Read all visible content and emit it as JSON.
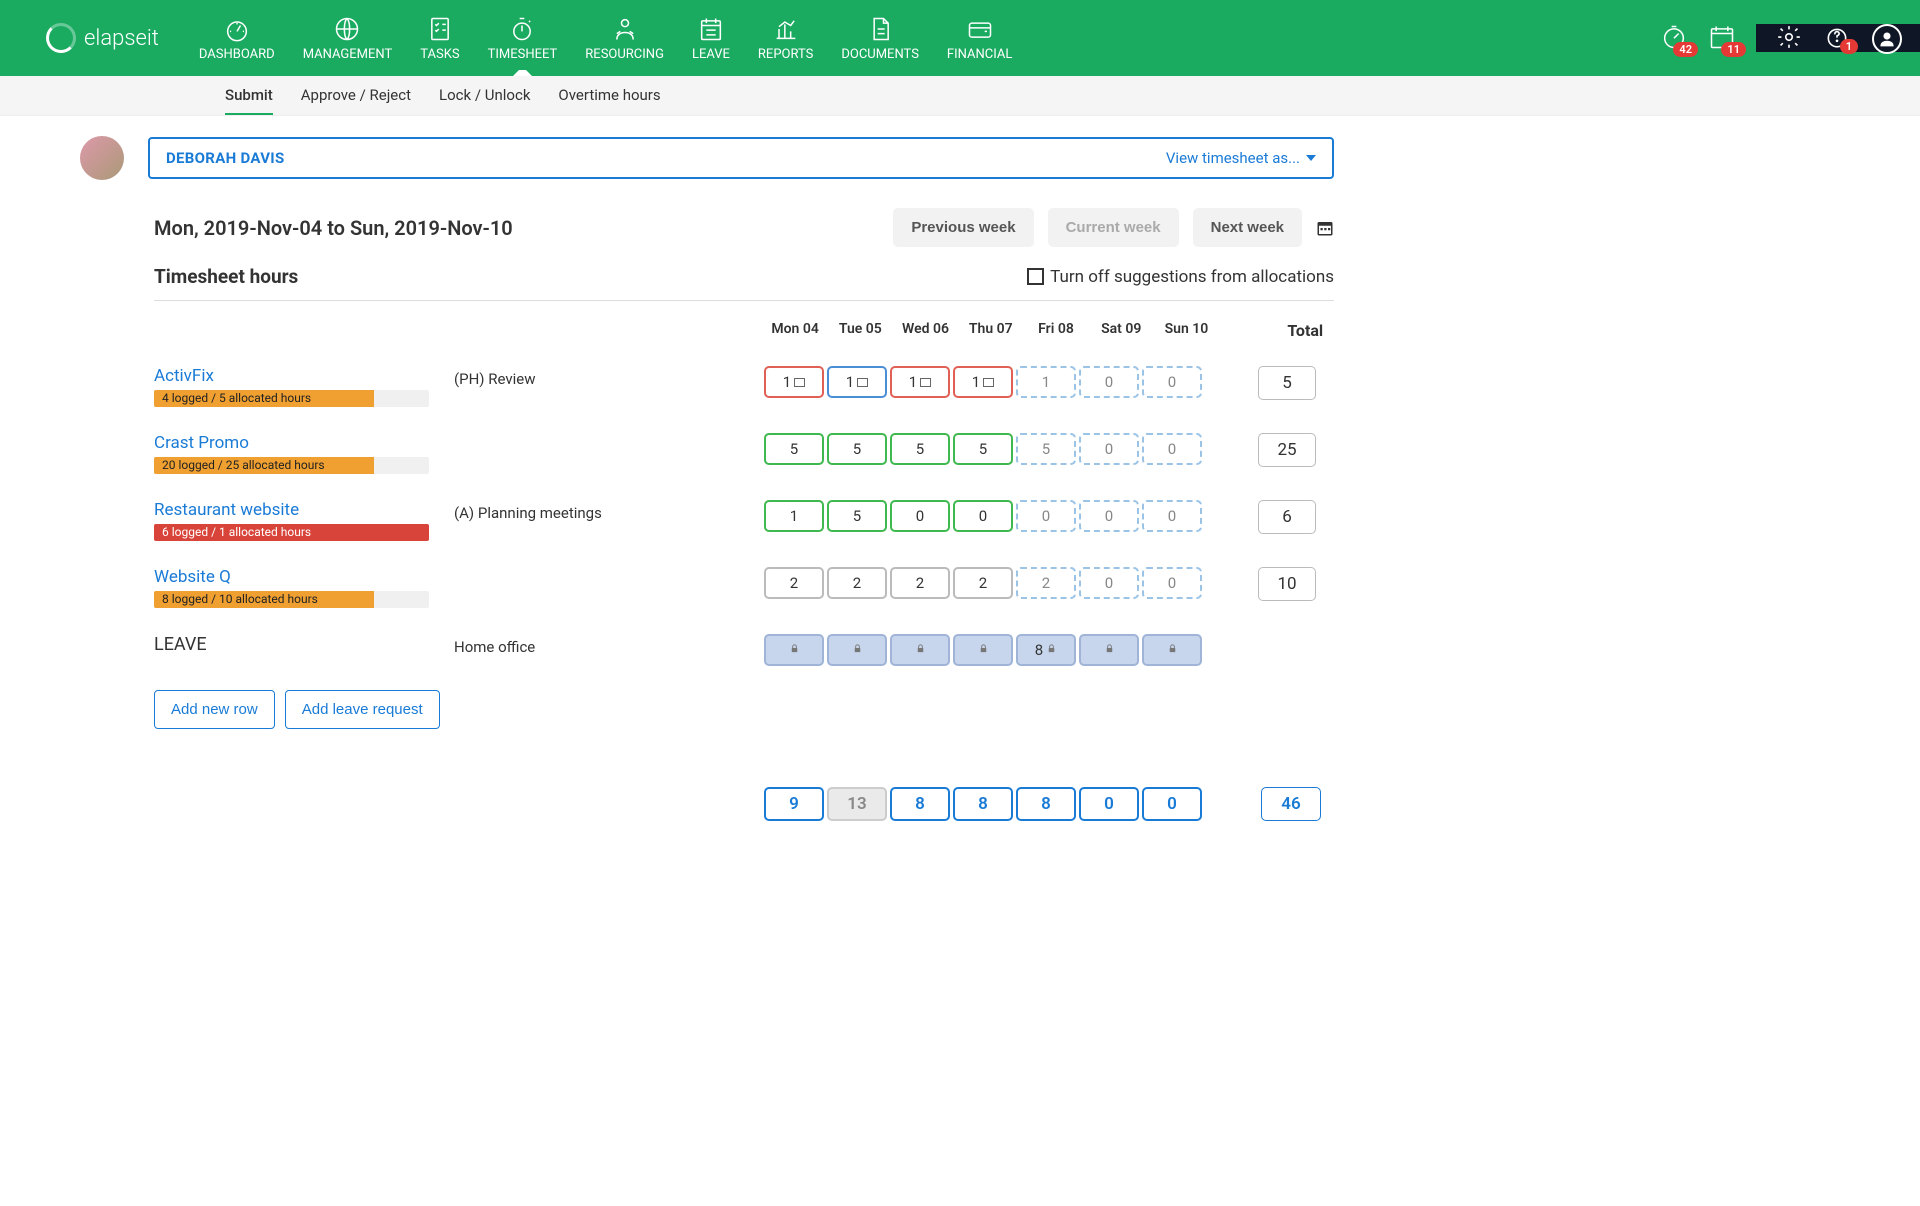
{
  "brand": "elapseit",
  "nav": {
    "items": [
      {
        "label": "DASHBOARD",
        "icon": "dashboard"
      },
      {
        "label": "MANAGEMENT",
        "icon": "globe"
      },
      {
        "label": "TASKS",
        "icon": "checklist"
      },
      {
        "label": "TIMESHEET",
        "icon": "stopwatch",
        "active": true
      },
      {
        "label": "RESOURCING",
        "icon": "person"
      },
      {
        "label": "LEAVE",
        "icon": "leave-cal"
      },
      {
        "label": "REPORTS",
        "icon": "chart"
      },
      {
        "label": "DOCUMENTS",
        "icon": "doc"
      },
      {
        "label": "FINANCIAL",
        "icon": "wallet"
      }
    ],
    "badges": {
      "timer": "42",
      "calendar": "11",
      "help": "1"
    }
  },
  "subnav": [
    "Submit",
    "Approve / Reject",
    "Lock / Unlock",
    "Overtime hours"
  ],
  "subnav_active": 0,
  "user": {
    "name": "DEBORAH DAVIS",
    "viewAs": "View timesheet as..."
  },
  "dateRange": "Mon, 2019-Nov-04 to Sun, 2019-Nov-10",
  "weekBtns": {
    "prev": "Previous week",
    "curr": "Current week",
    "next": "Next week"
  },
  "sectionTitle": "Timesheet hours",
  "suggestToggle": "Turn off suggestions from allocations",
  "dayHeaders": [
    "Mon 04",
    "Tue 05",
    "Wed 06",
    "Thu 07",
    "Fri 08",
    "Sat 09",
    "Sun 10"
  ],
  "totalHeader": "Total",
  "projects": [
    {
      "name": "ActivFix",
      "barText": "4 logged / 5 allocated hours",
      "barPct": 80,
      "barClass": "",
      "phase": "(PH) Review",
      "cells": [
        {
          "v": "1",
          "cls": "red",
          "note": true
        },
        {
          "v": "1",
          "cls": "blue",
          "note": true
        },
        {
          "v": "1",
          "cls": "red",
          "note": true
        },
        {
          "v": "1",
          "cls": "red",
          "note": true
        },
        {
          "v": "1",
          "cls": "dashed"
        },
        {
          "v": "0",
          "cls": "dashed"
        },
        {
          "v": "0",
          "cls": "dashed"
        }
      ],
      "total": "5"
    },
    {
      "name": "Crast Promo",
      "barText": "20 logged / 25 allocated hours",
      "barPct": 80,
      "barClass": "",
      "phase": "",
      "cells": [
        {
          "v": "5",
          "cls": "green"
        },
        {
          "v": "5",
          "cls": "green"
        },
        {
          "v": "5",
          "cls": "green"
        },
        {
          "v": "5",
          "cls": "green"
        },
        {
          "v": "5",
          "cls": "dashed"
        },
        {
          "v": "0",
          "cls": "dashed"
        },
        {
          "v": "0",
          "cls": "dashed"
        }
      ],
      "total": "25"
    },
    {
      "name": "Restaurant website",
      "barText": "6 logged / 1 allocated hours",
      "barPct": 100,
      "barClass": "over",
      "phase": "(A) Planning meetings",
      "cells": [
        {
          "v": "1",
          "cls": "green"
        },
        {
          "v": "5",
          "cls": "green"
        },
        {
          "v": "0",
          "cls": "green"
        },
        {
          "v": "0",
          "cls": "green"
        },
        {
          "v": "0",
          "cls": "dashed"
        },
        {
          "v": "0",
          "cls": "dashed"
        },
        {
          "v": "0",
          "cls": "dashed"
        }
      ],
      "total": "6"
    },
    {
      "name": "Website Q",
      "barText": "8 logged / 10 allocated hours",
      "barPct": 80,
      "barClass": "",
      "phase": "",
      "cells": [
        {
          "v": "2",
          "cls": ""
        },
        {
          "v": "2",
          "cls": ""
        },
        {
          "v": "2",
          "cls": ""
        },
        {
          "v": "2",
          "cls": ""
        },
        {
          "v": "2",
          "cls": "dashed"
        },
        {
          "v": "0",
          "cls": "dashed"
        },
        {
          "v": "0",
          "cls": "dashed"
        }
      ],
      "total": "10"
    }
  ],
  "leave": {
    "title": "LEAVE",
    "phase": "Home office",
    "cells": [
      {
        "v": "",
        "lock": true
      },
      {
        "v": "",
        "lock": true
      },
      {
        "v": "",
        "lock": true
      },
      {
        "v": "",
        "lock": true
      },
      {
        "v": "8",
        "lock": true
      },
      {
        "v": "",
        "lock": true
      },
      {
        "v": "",
        "lock": true
      }
    ]
  },
  "actions": {
    "addRow": "Add new row",
    "addLeave": "Add leave request"
  },
  "dayTotals": [
    "9",
    "13",
    "8",
    "8",
    "8",
    "0",
    "0"
  ],
  "dayTotalsMuted": [
    false,
    true,
    false,
    false,
    false,
    false,
    false
  ],
  "grandTotal": "46"
}
